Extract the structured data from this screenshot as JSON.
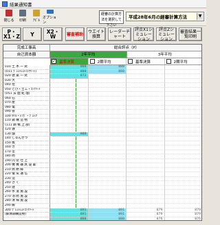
{
  "window": {
    "title": "結果通知書"
  },
  "toolbar": [
    {
      "label": "閉じる",
      "icon": "close-icon",
      "color": "#c03030"
    },
    {
      "label": "印刷",
      "icon": "print-icon",
      "color": "#607080"
    },
    {
      "label": "ｱﾋﾞﾙ",
      "icon": "help-icon",
      "color": "#d0a030"
    },
    {
      "label": "オプション",
      "icon": "options-icon",
      "color": "#3070c0"
    }
  ],
  "selector": {
    "label": "経審の計算方法を選択して下さい"
  },
  "method": {
    "value": "平成28年6月の経審計算方法"
  },
  "buttons": [
    {
      "label": "P・X1・Z",
      "style": "big"
    },
    {
      "label": "Y",
      "style": "big"
    },
    {
      "label": "X2・W",
      "style": "big"
    },
    {
      "label": "審査補助",
      "style": "red"
    },
    {
      "label": "ウエイト換算",
      "style": ""
    },
    {
      "label": "レーダーチャート",
      "style": ""
    },
    {
      "label": "評点X1シミュレーション",
      "style": ""
    },
    {
      "label": "評点Zシミュレーション",
      "style": ""
    },
    {
      "label": "審査結果一覧印刷",
      "style": ""
    }
  ],
  "grid": {
    "header_left": "完成工事高",
    "header_right": "総合評点（P）",
    "sub_left": "自己資本額",
    "periods": [
      "2年平均",
      "3年平均"
    ],
    "options": [
      {
        "label": "基準決算",
        "checked": true
      },
      {
        "label": "2期平均",
        "checked": false
      },
      {
        "label": "基準決算",
        "checked": false
      },
      {
        "label": "2期平均",
        "checked": false
      }
    ],
    "rows": [
      {
        "name": "010 土 木 一 式",
        "vals": [
          "888",
          "888",
          "",
          ""
        ],
        "cy": [
          1,
          1,
          0,
          0
        ]
      },
      {
        "name": "(011 ﾌﾟﾚｽﾄﾚｽﾄｺﾝｸﾘｰﾄ)",
        "vals": [
          "888",
          "888",
          "",
          ""
        ],
        "cy": [
          1,
          1,
          0,
          0
        ]
      },
      {
        "name": "020 建 築 一 式",
        "vals": [
          "872",
          "",
          "",
          ""
        ],
        "cy": [
          1,
          0,
          0,
          0
        ]
      },
      {
        "name": "030 大",
        "vals": [
          "",
          "",
          "",
          ""
        ],
        "cy": [
          0,
          0,
          0,
          0
        ]
      },
      {
        "name": "040 左",
        "vals": [
          "",
          "",
          "",
          ""
        ],
        "cy": [
          0,
          0,
          0,
          0
        ]
      },
      {
        "name": "050 とび・土工・ｺﾝｸﾘｰﾄ",
        "vals": [
          "",
          "",
          "",
          ""
        ],
        "cy": [
          0,
          0,
          0,
          0
        ]
      },
      {
        "name": "(051 法 面 処 理)",
        "vals": [
          "",
          "",
          "",
          ""
        ],
        "cy": [
          0,
          0,
          0,
          0
        ]
      },
      {
        "name": "060 石",
        "vals": [
          "",
          "",
          "",
          ""
        ],
        "cy": [
          0,
          0,
          0,
          0
        ]
      },
      {
        "name": "070 屋",
        "vals": [
          "",
          "",
          "",
          ""
        ],
        "cy": [
          0,
          0,
          0,
          0
        ]
      },
      {
        "name": "080 電",
        "vals": [
          "",
          "",
          "",
          ""
        ],
        "cy": [
          0,
          0,
          0,
          0
        ]
      },
      {
        "name": "090 管",
        "vals": [
          "",
          "",
          "",
          ""
        ],
        "cy": [
          0,
          0,
          0,
          0
        ]
      },
      {
        "name": "100 ﾀｲﾙ・ﾚﾝｶﾞ・ﾌﾞﾛｯｸ",
        "vals": [
          "",
          "",
          "",
          ""
        ],
        "cy": [
          0,
          0,
          0,
          0
        ]
      },
      {
        "name": "110 鋼 構 造 物",
        "vals": [
          "",
          "",
          "",
          ""
        ],
        "cy": [
          0,
          0,
          0,
          0
        ]
      },
      {
        "name": "(111 鋼 橋 上 部)",
        "vals": [
          "",
          "",
          "",
          ""
        ],
        "cy": [
          0,
          0,
          0,
          0
        ]
      },
      {
        "name": "120 鉄",
        "vals": [
          "",
          "",
          "",
          ""
        ],
        "cy": [
          0,
          0,
          0,
          0
        ]
      },
      {
        "name": "130 舗",
        "vals": [
          "888",
          "",
          "",
          ""
        ],
        "cy": [
          1,
          0,
          0,
          0
        ]
      },
      {
        "name": "140 しゅんせつ",
        "vals": [
          "",
          "",
          "",
          ""
        ],
        "cy": [
          0,
          0,
          0,
          0
        ]
      },
      {
        "name": "150 板",
        "vals": [
          "",
          "",
          "",
          ""
        ],
        "cy": [
          0,
          0,
          0,
          0
        ]
      },
      {
        "name": "160 ガ",
        "vals": [
          "",
          "",
          "",
          ""
        ],
        "cy": [
          0,
          0,
          0,
          0
        ]
      },
      {
        "name": "170 塗",
        "vals": [
          "",
          "",
          "",
          ""
        ],
        "cy": [
          0,
          0,
          0,
          0
        ]
      },
      {
        "name": "180 防",
        "vals": [
          "",
          "",
          "",
          ""
        ],
        "cy": [
          0,
          0,
          0,
          0
        ]
      },
      {
        "name": "190 内 装 仕 上",
        "vals": [
          "",
          "",
          "",
          ""
        ],
        "cy": [
          0,
          0,
          0,
          0
        ]
      },
      {
        "name": "200 機 械 器 具 設 置",
        "vals": [
          "",
          "",
          "",
          ""
        ],
        "cy": [
          0,
          0,
          0,
          0
        ]
      },
      {
        "name": "210 熱 絶 縁",
        "vals": [
          "",
          "",
          "",
          ""
        ],
        "cy": [
          0,
          0,
          0,
          0
        ]
      },
      {
        "name": "220 電 気 通 信",
        "vals": [
          "",
          "",
          "",
          ""
        ],
        "cy": [
          0,
          0,
          0,
          0
        ]
      },
      {
        "name": "230 造",
        "vals": [
          "",
          "",
          "",
          ""
        ],
        "cy": [
          0,
          0,
          0,
          0
        ]
      },
      {
        "name": "240 さ く",
        "vals": [
          "",
          "",
          "",
          ""
        ],
        "cy": [
          0,
          0,
          0,
          0
        ]
      },
      {
        "name": "250 建",
        "vals": [
          "",
          "",
          "",
          ""
        ],
        "cy": [
          0,
          0,
          0,
          0
        ]
      },
      {
        "name": "260 水 道 施 設",
        "vals": [
          "",
          "",
          "",
          ""
        ],
        "cy": [
          0,
          0,
          0,
          0
        ]
      },
      {
        "name": "270 消 防 施 設",
        "vals": [
          "",
          "",
          "",
          ""
        ],
        "cy": [
          0,
          0,
          0,
          0
        ]
      },
      {
        "name": "280 清 掃 施 設",
        "vals": [
          "",
          "",
          "",
          ""
        ],
        "cy": [
          0,
          0,
          0,
          0
        ]
      },
      {
        "name": "290 解",
        "vals": [
          "",
          "",
          "",
          ""
        ],
        "cy": [
          0,
          0,
          0,
          0
        ]
      },
      {
        "name": "300 ﾌﾟﾚｽﾄﾚｽﾄｺﾝｸﾘｰﾄ",
        "vals": [
          "891",
          "891",
          "879",
          "879"
        ],
        "cy": [
          1,
          1,
          0,
          0
        ]
      },
      {
        "name": "(解体鋼構造物)",
        "vals": [
          "891",
          "891",
          "879",
          "879"
        ],
        "cy": [
          1,
          1,
          0,
          0
        ]
      },
      {
        "name": "",
        "vals": [
          "888",
          "888",
          "876",
          "876"
        ],
        "cy": [
          1,
          1,
          0,
          0
        ]
      }
    ]
  }
}
